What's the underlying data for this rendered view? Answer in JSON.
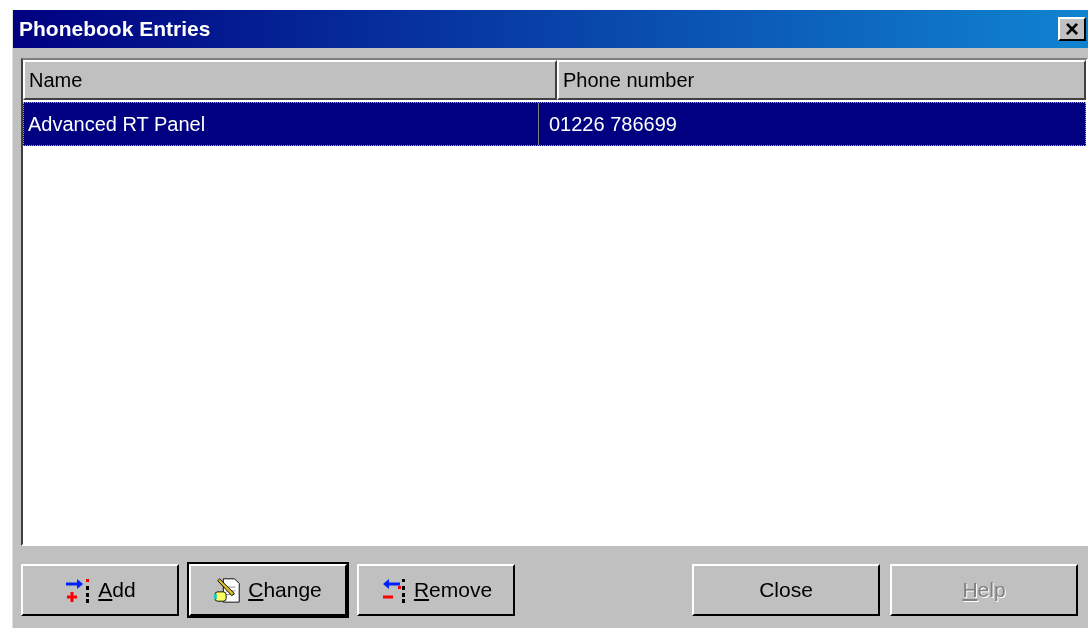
{
  "window": {
    "title": "Phonebook Entries",
    "close": "×"
  },
  "table": {
    "columns": [
      "Name",
      "Phone number"
    ],
    "rows": [
      {
        "cells": [
          "Advanced RT Panel",
          "01226 786699"
        ],
        "selected": true
      }
    ]
  },
  "buttons": [
    {
      "kind": "add",
      "accel": "A",
      "rest": "dd",
      "default": false,
      "disabled": false
    },
    {
      "kind": "change",
      "accel": "C",
      "rest": "hange",
      "default": true,
      "disabled": false
    },
    {
      "kind": "remove",
      "accel": "R",
      "rest": "emove",
      "default": false,
      "disabled": false
    },
    {
      "kind": "close",
      "rest": "Close",
      "default": false,
      "disabled": false
    },
    {
      "kind": "help",
      "accel": "H",
      "rest": "elp",
      "default": false,
      "disabled": true
    }
  ]
}
